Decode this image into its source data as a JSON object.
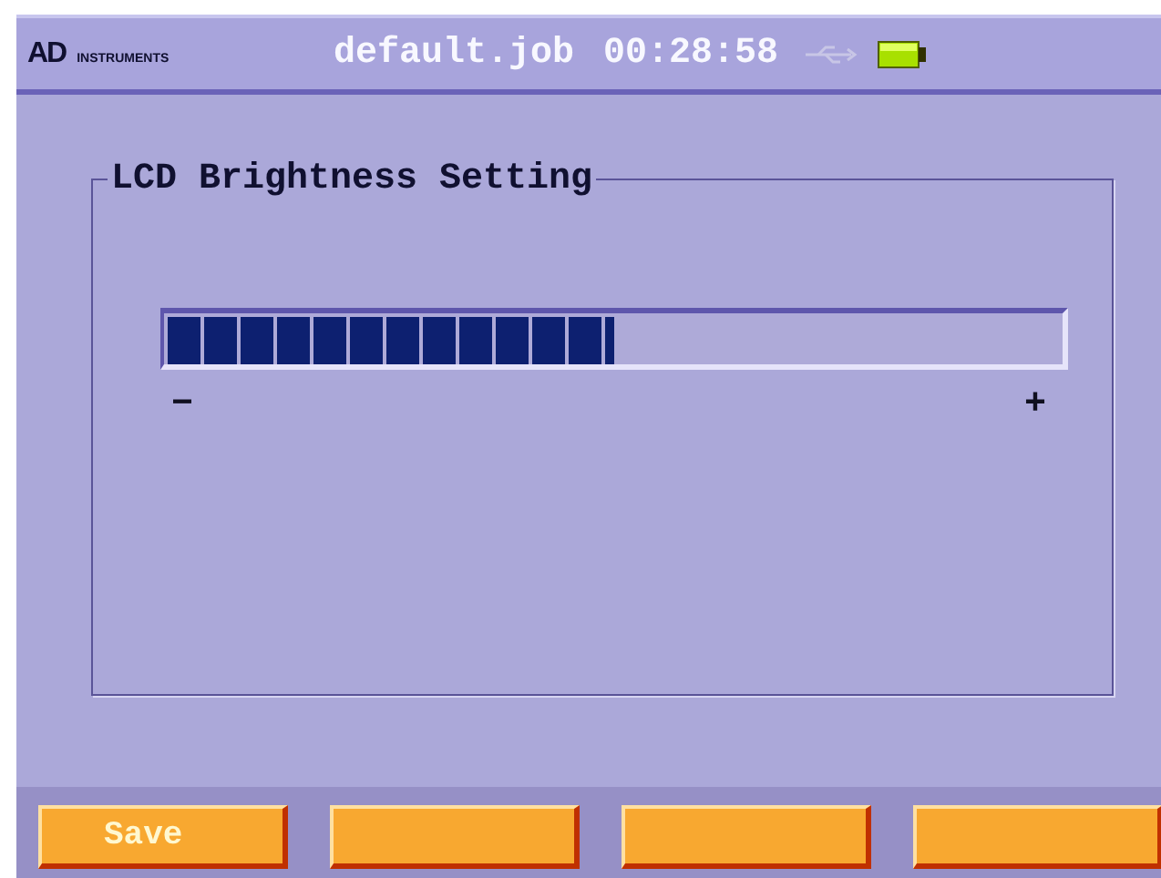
{
  "header": {
    "brand": "AD",
    "brand_sub": "INSTRUMENTS",
    "filename": "default.job",
    "time": "00:28:58"
  },
  "panel": {
    "title": "LCD Brightness Setting",
    "level": 0.5,
    "minus": "−",
    "plus": "+"
  },
  "soft_keys": [
    {
      "kind": "labeled",
      "label": "Save"
    },
    {
      "kind": "blank"
    },
    {
      "kind": "blank"
    },
    {
      "kind": "blank"
    }
  ]
}
